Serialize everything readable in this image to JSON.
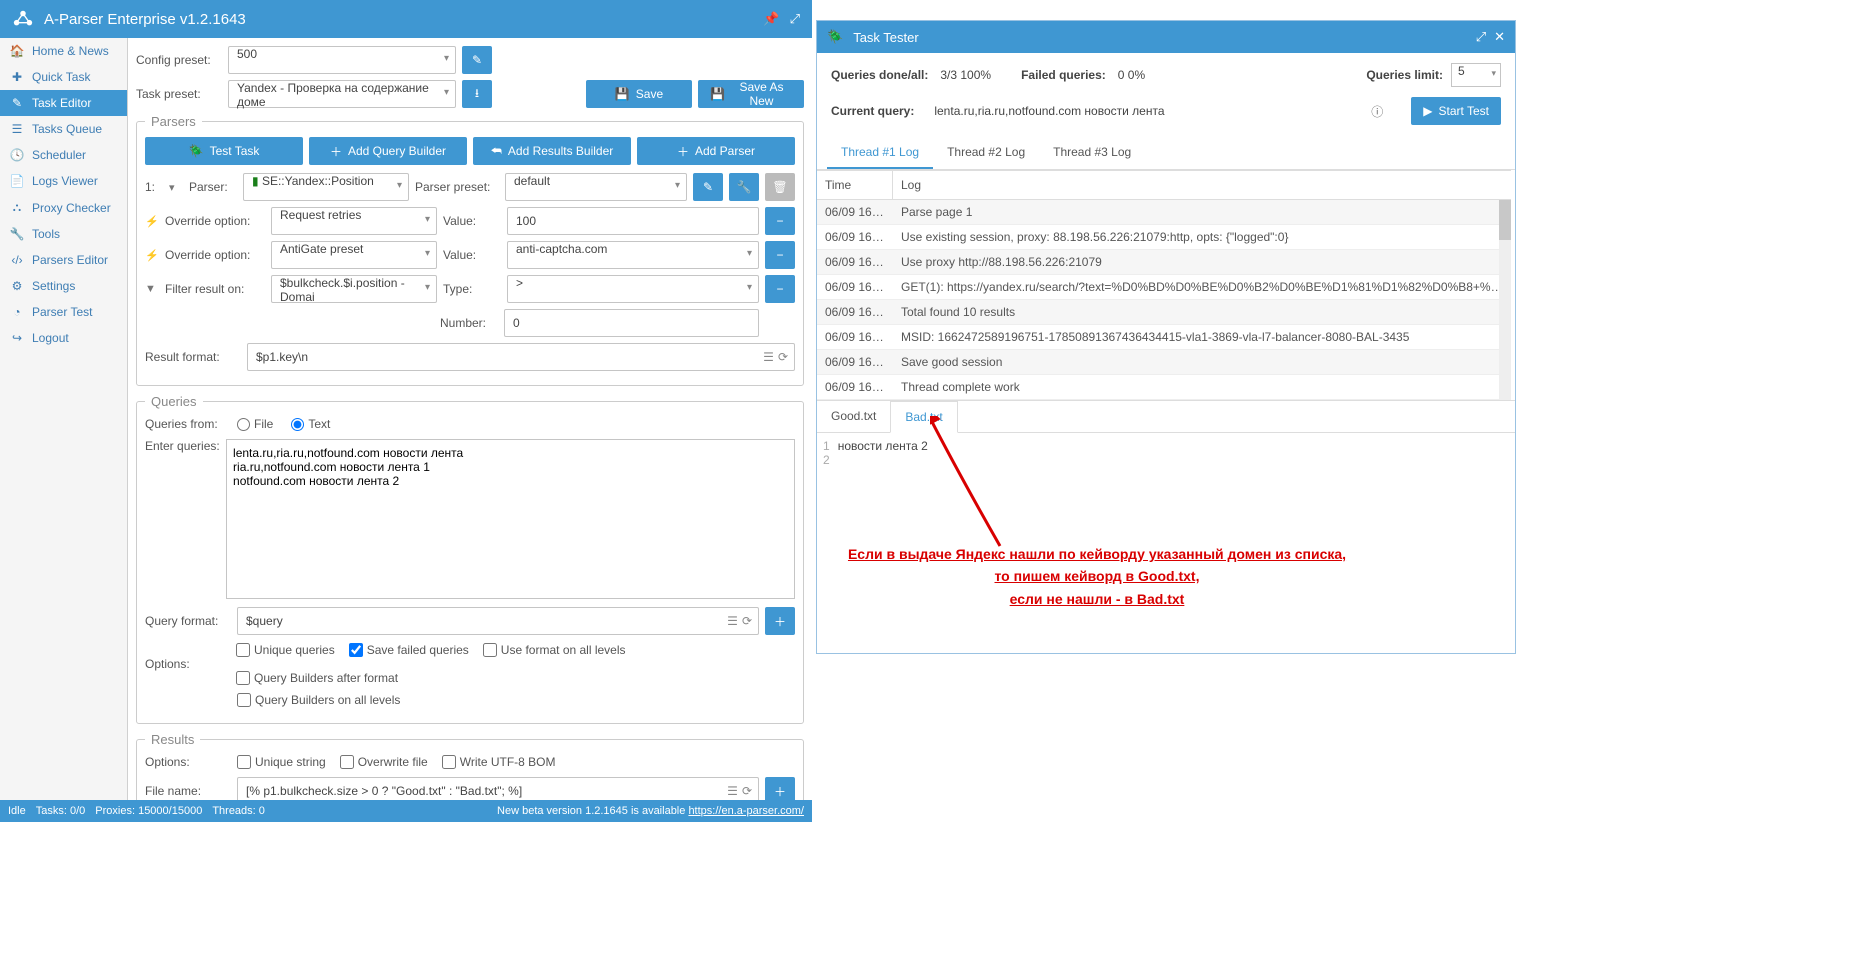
{
  "app": {
    "title": "A-Parser Enterprise v1.2.1643"
  },
  "sidebar": {
    "items": [
      {
        "label": "Home & News"
      },
      {
        "label": "Quick Task"
      },
      {
        "label": "Task Editor"
      },
      {
        "label": "Tasks Queue"
      },
      {
        "label": "Scheduler"
      },
      {
        "label": "Logs Viewer"
      },
      {
        "label": "Proxy Checker"
      },
      {
        "label": "Tools"
      },
      {
        "label": "Parsers Editor"
      },
      {
        "label": "Settings"
      },
      {
        "label": "Parser Test"
      },
      {
        "label": "Logout"
      }
    ]
  },
  "top": {
    "config_preset_label": "Config preset:",
    "config_preset_value": "500",
    "task_preset_label": "Task preset:",
    "task_preset_value": "Yandex - Проверка на содержание доме",
    "save": "Save",
    "save_as_new": "Save As New"
  },
  "parsers": {
    "legend": "Parsers",
    "test_task": "Test Task",
    "add_qb": "Add Query Builder",
    "add_rb": "Add Results Builder",
    "add_parser": "Add Parser",
    "idx": "1:",
    "parser_label": "Parser:",
    "parser_value": "SE::Yandex::Position",
    "preset_label": "Parser preset:",
    "preset_value": "default",
    "rows": [
      {
        "icon": "⚡",
        "l1": "Override option:",
        "v1": "Request retries",
        "l2": "Value:",
        "v2": "100",
        "type": "text"
      },
      {
        "icon": "⚡",
        "l1": "Override option:",
        "v1": "AntiGate preset",
        "l2": "Value:",
        "v2": "anti-captcha.com",
        "type": "select"
      },
      {
        "icon": "▼",
        "l1": "Filter result on:",
        "v1": "$bulkcheck.$i.position - Domai",
        "l2": "Type:",
        "v2": ">",
        "type": "select"
      }
    ],
    "number_label": "Number:",
    "number_value": "0",
    "result_format_label": "Result format:",
    "result_format_value": "$p1.key\\n"
  },
  "queries": {
    "legend": "Queries",
    "from_label": "Queries from:",
    "file": "File",
    "text": "Text",
    "enter_label": "Enter queries:",
    "content": "lenta.ru,ria.ru,notfound.com новости лента\nria.ru,notfound.com новости лента 1\nnotfound.com новости лента 2",
    "qf_label": "Query format:",
    "qf_value": "$query",
    "opts_label": "Options:",
    "o1": "Unique queries",
    "o2": "Save failed queries",
    "o3": "Use format on all levels",
    "o4": "Query Builders after format",
    "o5": "Query Builders on all levels"
  },
  "results": {
    "legend": "Results",
    "opts_label": "Options:",
    "o1": "Unique string",
    "o2": "Overwrite file",
    "o3": "Write UTF-8 BOM",
    "fn_label": "File name:",
    "fn_value": "[% p1.bulkcheck.size > 0 ? \"Good.txt\" : \"Bad.txt\"; %]"
  },
  "status": {
    "idle": "Idle",
    "tasks": "Tasks: 0/0",
    "proxies": "Proxies: 15000/15000",
    "threads": "Threads: 0",
    "beta_text": "New beta version 1.2.1645 is available ",
    "beta_link": "https://en.a-parser.com/"
  },
  "tester": {
    "title": "Task Tester",
    "q_done_l": "Queries done/all:",
    "q_done_v": "3/3 100%",
    "failed_l": "Failed queries:",
    "failed_v": "0 0%",
    "limit_l": "Queries limit:",
    "limit_v": "5",
    "start": "Start Test",
    "cur_l": "Current query:",
    "cur_v": "lenta.ru,ria.ru,notfound.com новости лента",
    "thread_tabs": [
      "Thread #1 Log",
      "Thread #2 Log",
      "Thread #3 Log"
    ],
    "col_time": "Time",
    "col_log": "Log",
    "rows": [
      {
        "t": "06/09 16:5...",
        "m": "Parse page 1"
      },
      {
        "t": "06/09 16:5...",
        "m": "Use existing session, proxy: 88.198.56.226:21079:http, opts: {\"logged\":0}"
      },
      {
        "t": "06/09 16:5...",
        "m": "Use proxy http://88.198.56.226:21079"
      },
      {
        "t": "06/09 16:5...",
        "m": "GET(1): https://yandex.ru/search/?text=%D0%BD%D0%BE%D0%B2%D0%BE%D1%81%D1%82%D0%B8+%D0%BB%D0%B5..."
      },
      {
        "t": "06/09 16:5...",
        "m": "Total found 10 results"
      },
      {
        "t": "06/09 16:5...",
        "m": "MSID: 1662472589196751-17850891367436434415-vla1-3869-vla-l7-balancer-8080-BAL-3435"
      },
      {
        "t": "06/09 16:5...",
        "m": "Save good session"
      },
      {
        "t": "06/09 16:5...",
        "m": "Thread complete work"
      }
    ],
    "file_tabs": [
      "Good.txt",
      "Bad.txt"
    ],
    "code_gutter": "1\n2",
    "code_lines": "новости лента 2\n"
  },
  "annotation": {
    "l1": "Если в выдаче Яндекс нашли по кейворду указанный домен из списка,",
    "l2": "то пишем кейворд в Good.txt,",
    "l3": "если не нашли - в Bad.txt"
  }
}
